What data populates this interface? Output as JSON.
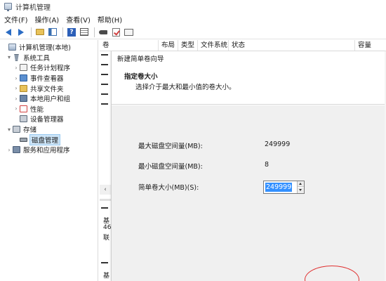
{
  "window": {
    "title": "计算机管理"
  },
  "menu": [
    {
      "label": "文件(F)"
    },
    {
      "label": "操作(A)"
    },
    {
      "label": "查看(V)"
    },
    {
      "label": "帮助(H)"
    }
  ],
  "toolbar": {
    "icons": [
      "back-arrow-icon",
      "forward-arrow-icon",
      "folder-icon",
      "show-pane-icon",
      "help-icon",
      "list-icon",
      "key-icon",
      "check-icon",
      "console-icon"
    ]
  },
  "tree": {
    "items": [
      {
        "label": "计算机管理(本地)",
        "icon": "computer-management-icon",
        "expander": ""
      },
      {
        "label": "系统工具",
        "icon": "system-tools-icon",
        "expander": "▾"
      },
      {
        "label": "任务计划程序",
        "icon": "task-scheduler-icon",
        "expander": "›"
      },
      {
        "label": "事件查看器",
        "icon": "event-viewer-icon",
        "expander": "›"
      },
      {
        "label": "共享文件夹",
        "icon": "shared-folder-icon",
        "expander": "›"
      },
      {
        "label": "本地用户和组",
        "icon": "local-users-icon",
        "expander": "›"
      },
      {
        "label": "性能",
        "icon": "performance-icon",
        "expander": "›"
      },
      {
        "label": "设备管理器",
        "icon": "device-manager-icon",
        "expander": ""
      },
      {
        "label": "存储",
        "icon": "storage-icon",
        "expander": "▾"
      },
      {
        "label": "磁盘管理",
        "icon": "disk-management-icon",
        "expander": ""
      },
      {
        "label": "服务和应用程序",
        "icon": "services-icon",
        "expander": "›"
      }
    ]
  },
  "volume_columns": [
    "卷",
    "布局",
    "类型",
    "文件系统",
    "状态",
    "容量"
  ],
  "disk_strip": {
    "row1": "基",
    "row2": "46",
    "row3": "联",
    "row4": "基",
    "scroll_left": "‹"
  },
  "wizard": {
    "title": "新建简单卷向导",
    "heading": "指定卷大小",
    "subtitle": "选择介于最大和最小值的卷大小。",
    "max_label": "最大磁盘空间量(MB):",
    "max_value": "249999",
    "min_label": "最小磁盘空间量(MB):",
    "min_value": "8",
    "size_label": "简单卷大小(MB)(S):",
    "size_value": "249999"
  },
  "colors": {
    "selection": "#3390ff",
    "highlight_oval": "#e03030",
    "tree_selected": "#cce4f7"
  }
}
